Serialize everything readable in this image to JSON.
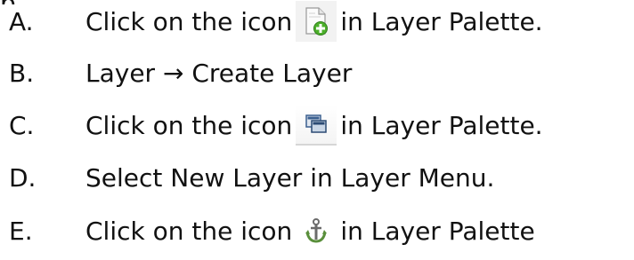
{
  "top_fragment": "p",
  "options": [
    {
      "letter": "A.",
      "text_before": "Click on the icon",
      "icon": "new-layer-icon",
      "text_after": "in Layer Palette."
    },
    {
      "letter": "B.",
      "text": "Layer → Create Layer"
    },
    {
      "letter": "C.",
      "text_before": "Click on the icon",
      "icon": "duplicate-layer-icon",
      "text_after": "in Layer Palette."
    },
    {
      "letter": "D.",
      "text": "Select New Layer in Layer Menu."
    },
    {
      "letter": "E.",
      "text_before": "Click on the icon",
      "icon": "anchor-layer-icon",
      "text_after": "in Layer Palette"
    }
  ],
  "colors": {
    "text": "#111111",
    "new_layer_plus": "#4caf2a",
    "duplicate_layer": "#3a5f8f",
    "anchor_layer": "#5a8f3c"
  }
}
